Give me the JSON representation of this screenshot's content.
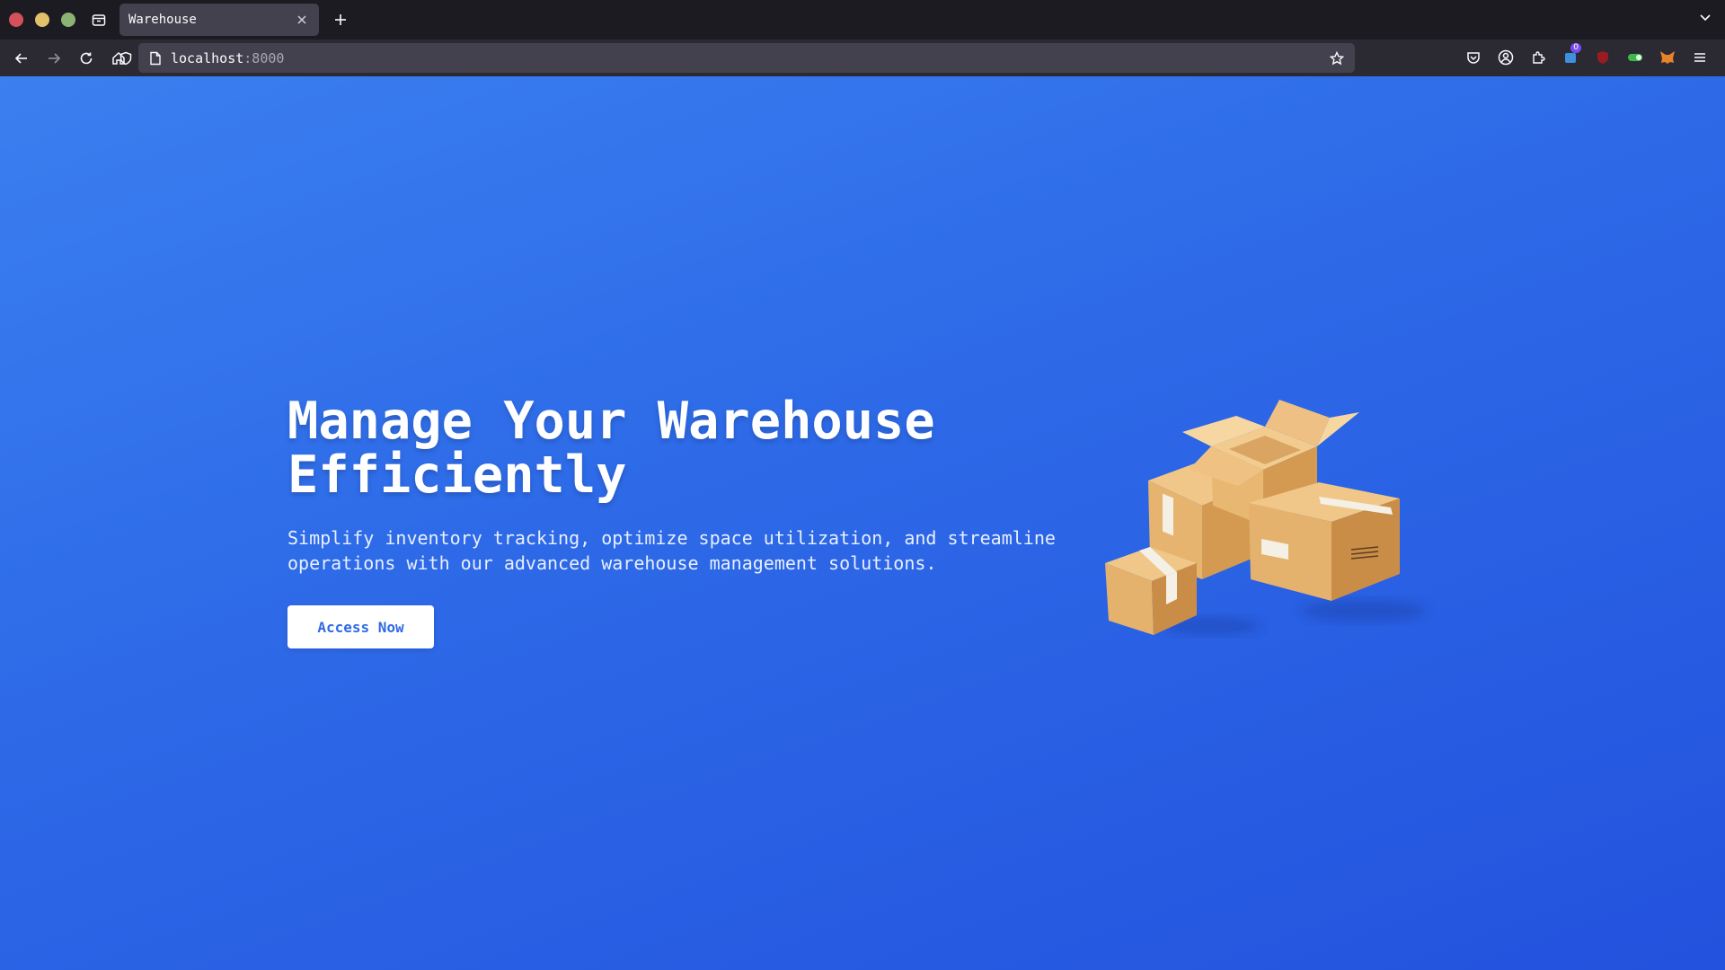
{
  "browser": {
    "tab_title": "Warehouse",
    "url_host": "localhost",
    "url_port": ":8000",
    "extension_badge": "0"
  },
  "hero": {
    "title_line1": "Manage Your Warehouse",
    "title_line2": "Efficiently",
    "subtitle_line1": "Simplify inventory tracking, optimize space utilization, and streamline",
    "subtitle_line2": "operations with our advanced warehouse management solutions.",
    "cta_label": "Access Now"
  },
  "colors": {
    "page_gradient_start": "#3b7ff0",
    "page_gradient_end": "#2352de",
    "cta_text": "#2f6ae6",
    "box_cardboard": "#e4b26c"
  },
  "icons": [
    "back-arrow-icon",
    "forward-arrow-icon",
    "reload-icon",
    "home-icon",
    "shield-icon",
    "page-icon",
    "star-icon",
    "pocket-icon",
    "account-icon",
    "extensions-icon",
    "menu-icon",
    "tab-overview-icon",
    "close-icon",
    "plus-icon",
    "chevron-down-icon",
    "boxes-illustration"
  ]
}
